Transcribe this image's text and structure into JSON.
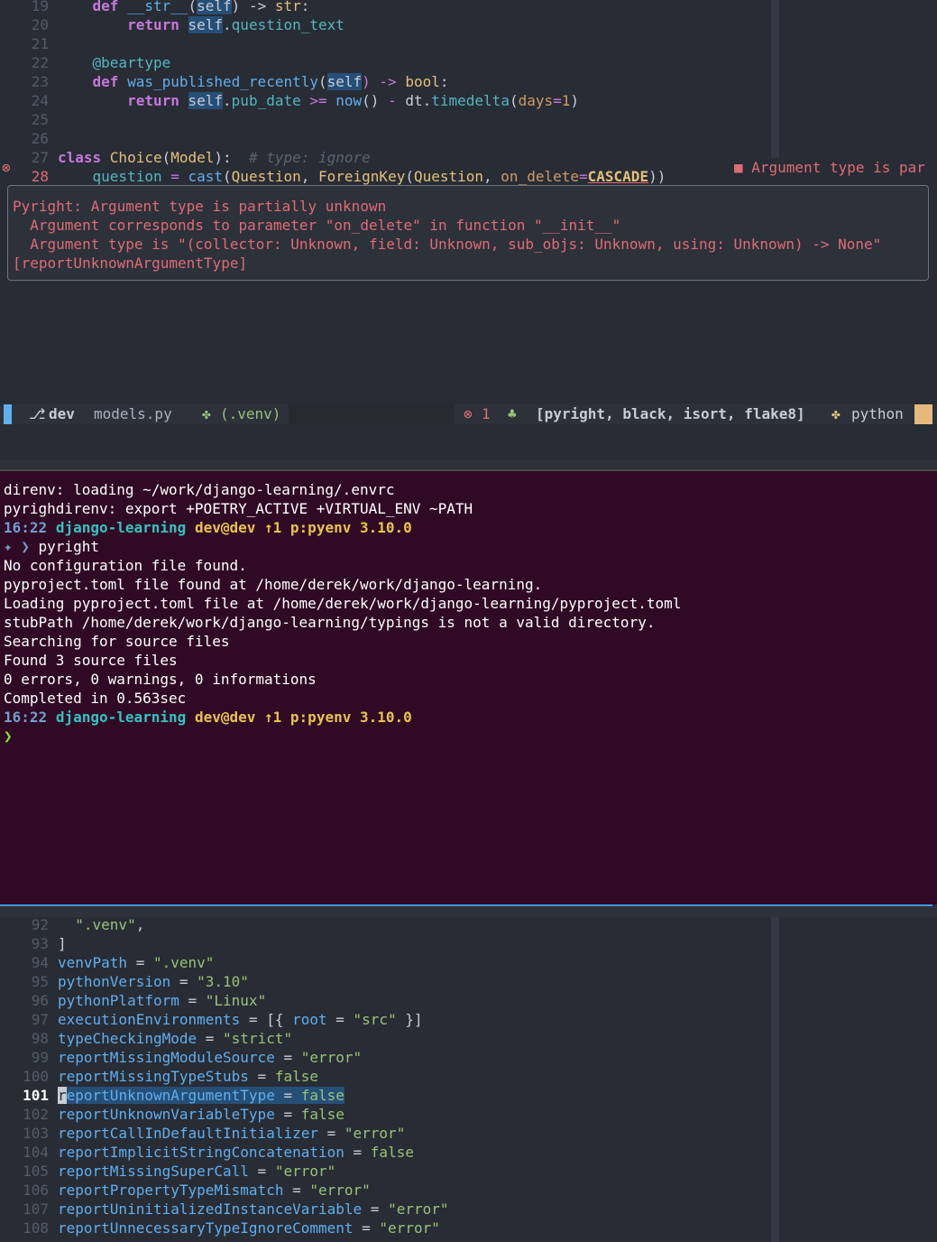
{
  "top_editor": {
    "lines": [
      {
        "n": "19",
        "parts": [
          [
            "kw",
            "    def "
          ],
          [
            "fn",
            "__str__"
          ],
          [
            "plain",
            "("
          ],
          [
            "self",
            "self"
          ],
          [
            "plain",
            ") -> "
          ],
          [
            "cls",
            "str"
          ],
          [
            "plain",
            ":"
          ]
        ]
      },
      {
        "n": "20",
        "parts": [
          [
            "kw",
            "        return "
          ],
          [
            "self",
            "self"
          ],
          [
            "plain",
            "."
          ],
          [
            "attr",
            "question_text"
          ]
        ]
      },
      {
        "n": "21",
        "parts": []
      },
      {
        "n": "22",
        "parts": [
          [
            "dec",
            "    @beartype"
          ]
        ]
      },
      {
        "n": "23",
        "parts": [
          [
            "kw",
            "    def "
          ],
          [
            "fn",
            "was_published_recently"
          ],
          [
            "plain",
            "("
          ],
          [
            "self",
            "self"
          ],
          [
            "op",
            ") -> "
          ],
          [
            "cls",
            "bool"
          ],
          [
            "plain",
            ":"
          ]
        ]
      },
      {
        "n": "24",
        "parts": [
          [
            "kw",
            "        return "
          ],
          [
            "self",
            "self"
          ],
          [
            "plain",
            "."
          ],
          [
            "attr",
            "pub_date"
          ],
          [
            "op",
            " >= "
          ],
          [
            "fn",
            "now"
          ],
          [
            "plain",
            "() "
          ],
          [
            "op",
            "-"
          ],
          [
            "plain",
            " dt."
          ],
          [
            "attr",
            "timedelta"
          ],
          [
            "plain",
            "("
          ],
          [
            "kwarg",
            "days"
          ],
          [
            "op",
            "="
          ],
          [
            "kwarg",
            "1"
          ],
          [
            "plain",
            ")"
          ]
        ]
      },
      {
        "n": "25",
        "parts": []
      },
      {
        "n": "26",
        "parts": []
      },
      {
        "n": "27",
        "parts": [
          [
            "kw",
            "class "
          ],
          [
            "cls",
            "Choice"
          ],
          [
            "plain",
            "("
          ],
          [
            "cls",
            "Model"
          ],
          [
            "plain",
            "):  "
          ],
          [
            "cmt",
            "# type: ignore"
          ]
        ]
      },
      {
        "n": "28",
        "parts": [
          [
            "attr",
            "    question"
          ],
          [
            "op",
            " = "
          ],
          [
            "fn",
            "cast"
          ],
          [
            "plain",
            "("
          ],
          [
            "cls",
            "Question"
          ],
          [
            "plain",
            ", "
          ],
          [
            "cls",
            "ForeignKey"
          ],
          [
            "plain",
            "("
          ],
          [
            "cls",
            "Question"
          ],
          [
            "plain",
            ", "
          ],
          [
            "kwarg",
            "on_delete"
          ],
          [
            "op",
            "="
          ],
          [
            "cascade",
            "CASCADE"
          ],
          [
            "plain",
            "))"
          ]
        ]
      }
    ],
    "error_sign": "⊗",
    "virtual_text": "■ Argument type is par",
    "popup": [
      "Pyright: Argument type is partially unknown",
      "  Argument corresponds to parameter \"on_delete\" in function \"__init__\"",
      "  Argument type is \"(collector: Unknown, field: Unknown, sub_objs: Unknown, using: Unknown) -> None\"",
      "[reportUnknownArgumentType]"
    ]
  },
  "statusbar": {
    "branch_icon": "⎇",
    "branch": "dev",
    "file": "models.py",
    "venv_icon": "✤",
    "venv": "(.venv)",
    "error_icon": "⊗",
    "error_count": "1",
    "lsp_icon": "♣",
    "linters": "[pyright, black, isort, flake8]",
    "lang_icon": "✤",
    "language": "python"
  },
  "terminal": {
    "lines": [
      "direnv: loading ~/work/django-learning/.envrc",
      "pyrighdirenv: export +POETRY_ACTIVE +VIRTUAL_ENV ~PATH"
    ],
    "prompt": {
      "time": "16:22",
      "dir": "django-learning",
      "git": "dev@dev ↑1 p:pyenv 3.10.0"
    },
    "command_prefix": "✦ ❯ ",
    "command": "pyright",
    "output": [
      "No configuration file found.",
      "pyproject.toml file found at /home/derek/work/django-learning.",
      "Loading pyproject.toml file at /home/derek/work/django-learning/pyproject.toml",
      "stubPath /home/derek/work/django-learning/typings is not a valid directory.",
      "Searching for source files",
      "Found 3 source files",
      "0 errors, 0 warnings, 0 informations",
      "Completed in 0.563sec"
    ],
    "prompt2": {
      "time": "16:22",
      "dir": "django-learning",
      "git": "dev@dev ↑1 p:pyenv 3.10.0"
    },
    "cursor_prompt": "❯"
  },
  "bottom_editor": {
    "lines": [
      {
        "n": "92",
        "parts": [
          [
            "plain",
            "  "
          ],
          [
            "val",
            "\".venv\""
          ],
          [
            "plain",
            ","
          ]
        ]
      },
      {
        "n": "93",
        "parts": [
          [
            "plain",
            "]"
          ]
        ]
      },
      {
        "n": "94",
        "parts": [
          [
            "key",
            "venvPath"
          ],
          [
            "plain",
            " = "
          ],
          [
            "val",
            "\".venv\""
          ]
        ]
      },
      {
        "n": "95",
        "parts": [
          [
            "key",
            "pythonVersion"
          ],
          [
            "plain",
            " = "
          ],
          [
            "val",
            "\"3.10\""
          ]
        ]
      },
      {
        "n": "96",
        "parts": [
          [
            "key",
            "pythonPlatform"
          ],
          [
            "plain",
            " = "
          ],
          [
            "val",
            "\"Linux\""
          ]
        ]
      },
      {
        "n": "97",
        "parts": [
          [
            "key",
            "executionEnvironments"
          ],
          [
            "plain",
            " = [{ "
          ],
          [
            "key",
            "root"
          ],
          [
            "plain",
            " = "
          ],
          [
            "val",
            "\"src\""
          ],
          [
            "plain",
            " }]"
          ]
        ]
      },
      {
        "n": "98",
        "parts": [
          [
            "key",
            "typeCheckingMode"
          ],
          [
            "plain",
            " = "
          ],
          [
            "val",
            "\"strict\""
          ]
        ]
      },
      {
        "n": "99",
        "parts": [
          [
            "key",
            "reportMissingModuleSource"
          ],
          [
            "plain",
            " = "
          ],
          [
            "val",
            "\"error\""
          ]
        ]
      },
      {
        "n": "100",
        "parts": [
          [
            "key",
            "reportMissingTypeStubs"
          ],
          [
            "plain",
            " = "
          ],
          [
            "val",
            "false"
          ]
        ]
      },
      {
        "n": "101",
        "parts": [
          [
            "cur",
            "r"
          ],
          [
            "selkey",
            "eportUnknownArgumentType"
          ],
          [
            "selplain",
            " = "
          ],
          [
            "selval",
            "false"
          ]
        ]
      },
      {
        "n": "102",
        "parts": [
          [
            "key",
            "reportUnknownVariableType"
          ],
          [
            "plain",
            " = "
          ],
          [
            "val",
            "false"
          ]
        ]
      },
      {
        "n": "103",
        "parts": [
          [
            "key",
            "reportCallInDefaultInitializer"
          ],
          [
            "plain",
            " = "
          ],
          [
            "val",
            "\"error\""
          ]
        ]
      },
      {
        "n": "104",
        "parts": [
          [
            "key",
            "reportImplicitStringConcatenation"
          ],
          [
            "plain",
            " = "
          ],
          [
            "val",
            "false"
          ]
        ]
      },
      {
        "n": "105",
        "parts": [
          [
            "key",
            "reportMissingSuperCall"
          ],
          [
            "plain",
            " = "
          ],
          [
            "val",
            "\"error\""
          ]
        ]
      },
      {
        "n": "106",
        "parts": [
          [
            "key",
            "reportPropertyTypeMismatch"
          ],
          [
            "plain",
            " = "
          ],
          [
            "val",
            "\"error\""
          ]
        ]
      },
      {
        "n": "107",
        "parts": [
          [
            "key",
            "reportUninitializedInstanceVariable"
          ],
          [
            "plain",
            " = "
          ],
          [
            "val",
            "\"error\""
          ]
        ]
      },
      {
        "n": "108",
        "parts": [
          [
            "key",
            "reportUnnecessaryTypeIgnoreComment"
          ],
          [
            "plain",
            " = "
          ],
          [
            "val",
            "\"error\""
          ]
        ]
      }
    ],
    "current_line": "101"
  }
}
